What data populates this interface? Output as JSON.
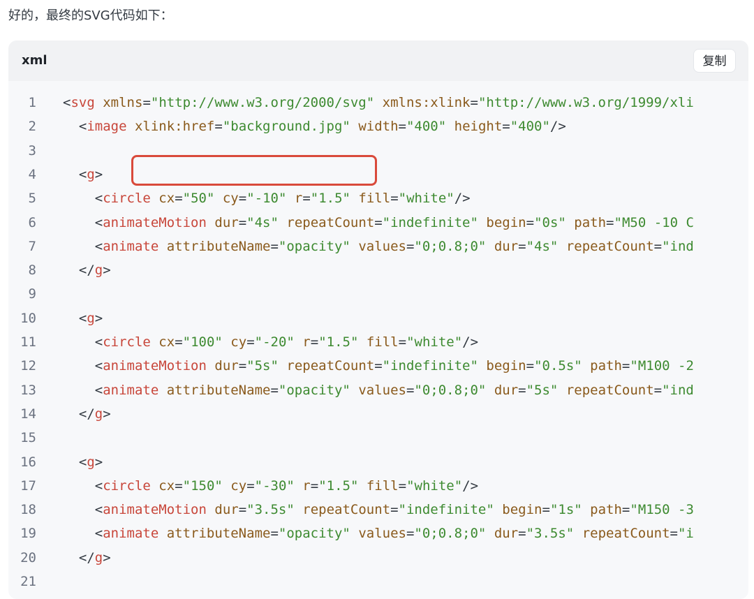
{
  "intro_text": "好的，最终的SVG代码如下：",
  "code_block": {
    "language": "xml",
    "copy_label": "复制",
    "lines": [
      {
        "n": "1",
        "tokens": [
          [
            "punct",
            "<"
          ],
          [
            "tag",
            "svg"
          ],
          [
            "punct",
            " "
          ],
          [
            "attr",
            "xmlns"
          ],
          [
            "punct",
            "="
          ],
          [
            "str",
            "\"http://www.w3.org/2000/svg\""
          ],
          [
            "punct",
            " "
          ],
          [
            "attr",
            "xmlns:xlink"
          ],
          [
            "punct",
            "="
          ],
          [
            "str",
            "\"http://www.w3.org/1999/xli"
          ]
        ]
      },
      {
        "n": "2",
        "tokens": [
          [
            "punct",
            "  <"
          ],
          [
            "tag",
            "image"
          ],
          [
            "punct",
            " "
          ],
          [
            "attr",
            "xlink:href"
          ],
          [
            "punct",
            "="
          ],
          [
            "str",
            "\"background.jpg\""
          ],
          [
            "punct",
            " "
          ],
          [
            "attr",
            "width"
          ],
          [
            "punct",
            "="
          ],
          [
            "str",
            "\"400\""
          ],
          [
            "punct",
            " "
          ],
          [
            "attr",
            "height"
          ],
          [
            "punct",
            "="
          ],
          [
            "str",
            "\"400\""
          ],
          [
            "punct",
            "/>"
          ]
        ]
      },
      {
        "n": "3",
        "tokens": []
      },
      {
        "n": "4",
        "tokens": [
          [
            "punct",
            "  <"
          ],
          [
            "tag",
            "g"
          ],
          [
            "punct",
            ">"
          ]
        ]
      },
      {
        "n": "5",
        "tokens": [
          [
            "punct",
            "    <"
          ],
          [
            "tag",
            "circle"
          ],
          [
            "punct",
            " "
          ],
          [
            "attr",
            "cx"
          ],
          [
            "punct",
            "="
          ],
          [
            "str",
            "\"50\""
          ],
          [
            "punct",
            " "
          ],
          [
            "attr",
            "cy"
          ],
          [
            "punct",
            "="
          ],
          [
            "str",
            "\"-10\""
          ],
          [
            "punct",
            " "
          ],
          [
            "attr",
            "r"
          ],
          [
            "punct",
            "="
          ],
          [
            "str",
            "\"1.5\""
          ],
          [
            "punct",
            " "
          ],
          [
            "attr",
            "fill"
          ],
          [
            "punct",
            "="
          ],
          [
            "str",
            "\"white\""
          ],
          [
            "punct",
            "/>"
          ]
        ]
      },
      {
        "n": "6",
        "tokens": [
          [
            "punct",
            "    <"
          ],
          [
            "tag",
            "animateMotion"
          ],
          [
            "punct",
            " "
          ],
          [
            "attr",
            "dur"
          ],
          [
            "punct",
            "="
          ],
          [
            "str",
            "\"4s\""
          ],
          [
            "punct",
            " "
          ],
          [
            "attr",
            "repeatCount"
          ],
          [
            "punct",
            "="
          ],
          [
            "str",
            "\"indefinite\""
          ],
          [
            "punct",
            " "
          ],
          [
            "attr",
            "begin"
          ],
          [
            "punct",
            "="
          ],
          [
            "str",
            "\"0s\""
          ],
          [
            "punct",
            " "
          ],
          [
            "attr",
            "path"
          ],
          [
            "punct",
            "="
          ],
          [
            "str",
            "\"M50 -10 C"
          ]
        ]
      },
      {
        "n": "7",
        "tokens": [
          [
            "punct",
            "    <"
          ],
          [
            "tag",
            "animate"
          ],
          [
            "punct",
            " "
          ],
          [
            "attr",
            "attributeName"
          ],
          [
            "punct",
            "="
          ],
          [
            "str",
            "\"opacity\""
          ],
          [
            "punct",
            " "
          ],
          [
            "attr",
            "values"
          ],
          [
            "punct",
            "="
          ],
          [
            "str",
            "\"0;0.8;0\""
          ],
          [
            "punct",
            " "
          ],
          [
            "attr",
            "dur"
          ],
          [
            "punct",
            "="
          ],
          [
            "str",
            "\"4s\""
          ],
          [
            "punct",
            " "
          ],
          [
            "attr",
            "repeatCount"
          ],
          [
            "punct",
            "="
          ],
          [
            "str",
            "\"ind"
          ]
        ]
      },
      {
        "n": "8",
        "tokens": [
          [
            "punct",
            "  </"
          ],
          [
            "tag",
            "g"
          ],
          [
            "punct",
            ">"
          ]
        ]
      },
      {
        "n": "9",
        "tokens": []
      },
      {
        "n": "10",
        "tokens": [
          [
            "punct",
            "  <"
          ],
          [
            "tag",
            "g"
          ],
          [
            "punct",
            ">"
          ]
        ]
      },
      {
        "n": "11",
        "tokens": [
          [
            "punct",
            "    <"
          ],
          [
            "tag",
            "circle"
          ],
          [
            "punct",
            " "
          ],
          [
            "attr",
            "cx"
          ],
          [
            "punct",
            "="
          ],
          [
            "str",
            "\"100\""
          ],
          [
            "punct",
            " "
          ],
          [
            "attr",
            "cy"
          ],
          [
            "punct",
            "="
          ],
          [
            "str",
            "\"-20\""
          ],
          [
            "punct",
            " "
          ],
          [
            "attr",
            "r"
          ],
          [
            "punct",
            "="
          ],
          [
            "str",
            "\"1.5\""
          ],
          [
            "punct",
            " "
          ],
          [
            "attr",
            "fill"
          ],
          [
            "punct",
            "="
          ],
          [
            "str",
            "\"white\""
          ],
          [
            "punct",
            "/>"
          ]
        ]
      },
      {
        "n": "12",
        "tokens": [
          [
            "punct",
            "    <"
          ],
          [
            "tag",
            "animateMotion"
          ],
          [
            "punct",
            " "
          ],
          [
            "attr",
            "dur"
          ],
          [
            "punct",
            "="
          ],
          [
            "str",
            "\"5s\""
          ],
          [
            "punct",
            " "
          ],
          [
            "attr",
            "repeatCount"
          ],
          [
            "punct",
            "="
          ],
          [
            "str",
            "\"indefinite\""
          ],
          [
            "punct",
            " "
          ],
          [
            "attr",
            "begin"
          ],
          [
            "punct",
            "="
          ],
          [
            "str",
            "\"0.5s\""
          ],
          [
            "punct",
            " "
          ],
          [
            "attr",
            "path"
          ],
          [
            "punct",
            "="
          ],
          [
            "str",
            "\"M100 -2"
          ]
        ]
      },
      {
        "n": "13",
        "tokens": [
          [
            "punct",
            "    <"
          ],
          [
            "tag",
            "animate"
          ],
          [
            "punct",
            " "
          ],
          [
            "attr",
            "attributeName"
          ],
          [
            "punct",
            "="
          ],
          [
            "str",
            "\"opacity\""
          ],
          [
            "punct",
            " "
          ],
          [
            "attr",
            "values"
          ],
          [
            "punct",
            "="
          ],
          [
            "str",
            "\"0;0.8;0\""
          ],
          [
            "punct",
            " "
          ],
          [
            "attr",
            "dur"
          ],
          [
            "punct",
            "="
          ],
          [
            "str",
            "\"5s\""
          ],
          [
            "punct",
            " "
          ],
          [
            "attr",
            "repeatCount"
          ],
          [
            "punct",
            "="
          ],
          [
            "str",
            "\"ind"
          ]
        ]
      },
      {
        "n": "14",
        "tokens": [
          [
            "punct",
            "  </"
          ],
          [
            "tag",
            "g"
          ],
          [
            "punct",
            ">"
          ]
        ]
      },
      {
        "n": "15",
        "tokens": []
      },
      {
        "n": "16",
        "tokens": [
          [
            "punct",
            "  <"
          ],
          [
            "tag",
            "g"
          ],
          [
            "punct",
            ">"
          ]
        ]
      },
      {
        "n": "17",
        "tokens": [
          [
            "punct",
            "    <"
          ],
          [
            "tag",
            "circle"
          ],
          [
            "punct",
            " "
          ],
          [
            "attr",
            "cx"
          ],
          [
            "punct",
            "="
          ],
          [
            "str",
            "\"150\""
          ],
          [
            "punct",
            " "
          ],
          [
            "attr",
            "cy"
          ],
          [
            "punct",
            "="
          ],
          [
            "str",
            "\"-30\""
          ],
          [
            "punct",
            " "
          ],
          [
            "attr",
            "r"
          ],
          [
            "punct",
            "="
          ],
          [
            "str",
            "\"1.5\""
          ],
          [
            "punct",
            " "
          ],
          [
            "attr",
            "fill"
          ],
          [
            "punct",
            "="
          ],
          [
            "str",
            "\"white\""
          ],
          [
            "punct",
            "/>"
          ]
        ]
      },
      {
        "n": "18",
        "tokens": [
          [
            "punct",
            "    <"
          ],
          [
            "tag",
            "animateMotion"
          ],
          [
            "punct",
            " "
          ],
          [
            "attr",
            "dur"
          ],
          [
            "punct",
            "="
          ],
          [
            "str",
            "\"3.5s\""
          ],
          [
            "punct",
            " "
          ],
          [
            "attr",
            "repeatCount"
          ],
          [
            "punct",
            "="
          ],
          [
            "str",
            "\"indefinite\""
          ],
          [
            "punct",
            " "
          ],
          [
            "attr",
            "begin"
          ],
          [
            "punct",
            "="
          ],
          [
            "str",
            "\"1s\""
          ],
          [
            "punct",
            " "
          ],
          [
            "attr",
            "path"
          ],
          [
            "punct",
            "="
          ],
          [
            "str",
            "\"M150 -3"
          ]
        ]
      },
      {
        "n": "19",
        "tokens": [
          [
            "punct",
            "    <"
          ],
          [
            "tag",
            "animate"
          ],
          [
            "punct",
            " "
          ],
          [
            "attr",
            "attributeName"
          ],
          [
            "punct",
            "="
          ],
          [
            "str",
            "\"opacity\""
          ],
          [
            "punct",
            " "
          ],
          [
            "attr",
            "values"
          ],
          [
            "punct",
            "="
          ],
          [
            "str",
            "\"0;0.8;0\""
          ],
          [
            "punct",
            " "
          ],
          [
            "attr",
            "dur"
          ],
          [
            "punct",
            "="
          ],
          [
            "str",
            "\"3.5s\""
          ],
          [
            "punct",
            " "
          ],
          [
            "attr",
            "repeatCount"
          ],
          [
            "punct",
            "="
          ],
          [
            "str",
            "\"i"
          ]
        ]
      },
      {
        "n": "20",
        "tokens": [
          [
            "punct",
            "  </"
          ],
          [
            "tag",
            "g"
          ],
          [
            "punct",
            ">"
          ]
        ]
      },
      {
        "n": "21",
        "tokens": []
      }
    ]
  },
  "colors": {
    "tag": "#c8463a",
    "attribute": "#8a5a1c",
    "string": "#3d8a30",
    "highlight_border": "#d94a3b"
  }
}
